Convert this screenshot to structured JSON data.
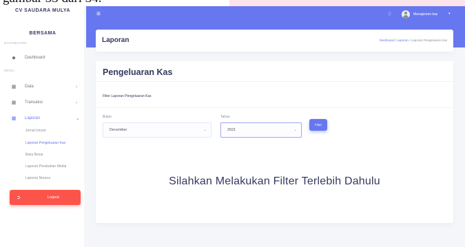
{
  "document_fragment": "gambar 33 dari 34.",
  "sidebar": {
    "brand_top": "CV SAUDARA MULYA",
    "brand_sub": "BERSAMA",
    "header_dashboard": "DASHBOARD",
    "item_dashboard": "Dashboard",
    "header_menu": "MENU",
    "item_data": "Data",
    "item_transaksi": "Transaksi",
    "item_laporan": "Laporan",
    "sub_items": [
      "Jurnal Umum",
      "Laporan Pengeluaran Kas",
      "Buku Besar",
      "Laporan Perubahan Modal",
      "Laporan Neraca"
    ],
    "active_sub_index": 1,
    "logout_label": "Logout"
  },
  "navbar": {
    "user_name": "Manajemen kas"
  },
  "section": {
    "title": "Laporan",
    "breadcrumb": [
      "Dashboard",
      "Laporan",
      "Laporan Pengeluaran Kas"
    ]
  },
  "card": {
    "title": "Pengeluaran Kas",
    "filter_label": "Filter Laporan Pengeluaran Kas",
    "bulan_label": "Bulan",
    "bulan_value": "December",
    "tahun_label": "Tahun",
    "tahun_value": "2021",
    "filter_button": "Filter",
    "empty_message": "Silahkan Melakukan Filter Terlebih Dahulu"
  },
  "colors": {
    "primary": "#6777ef",
    "danger": "#fc544b",
    "background": "#f4f6f9"
  }
}
